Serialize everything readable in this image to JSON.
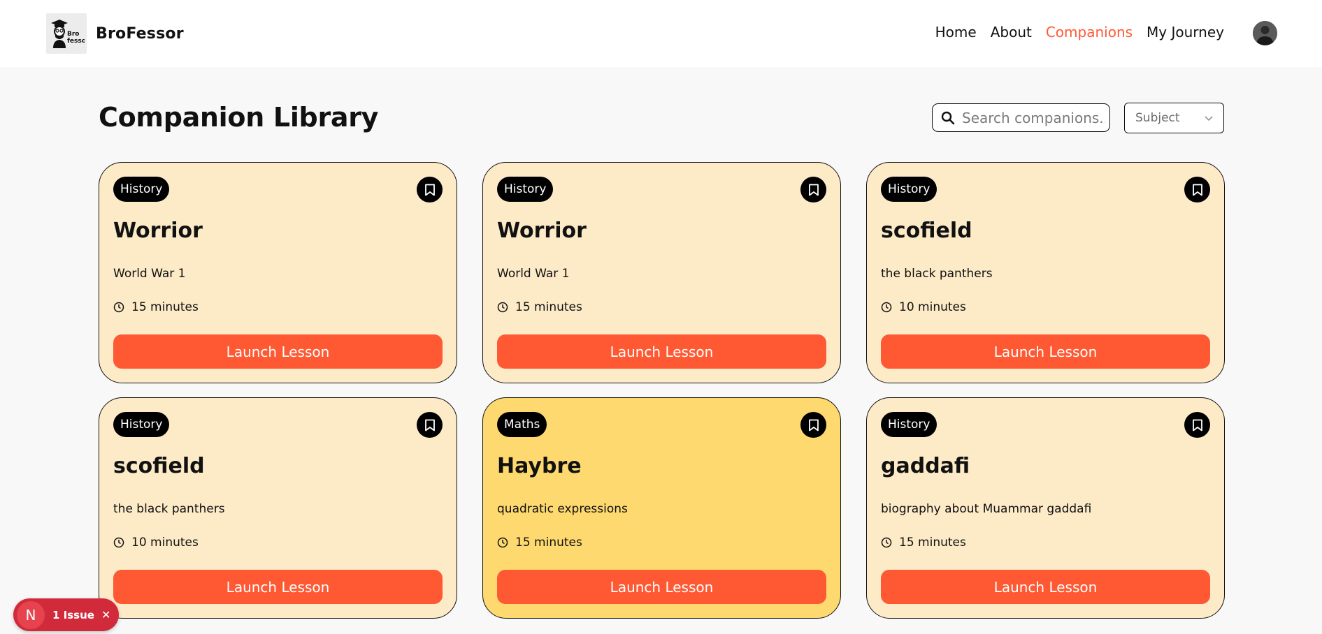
{
  "brand": {
    "name": "BroFessor",
    "logo_text_top": "Bro",
    "logo_text_bottom": "fessor"
  },
  "nav": {
    "links": [
      {
        "label": "Home",
        "active": false
      },
      {
        "label": "About",
        "active": false
      },
      {
        "label": "Companions",
        "active": true
      },
      {
        "label": "My Journey",
        "active": false
      }
    ]
  },
  "page": {
    "title": "Companion Library"
  },
  "search": {
    "placeholder": "Search companions...",
    "value": ""
  },
  "filter": {
    "subject_label": "Subject"
  },
  "cards": [
    {
      "subject": "History",
      "name": "Worrior",
      "topic": "World War 1",
      "duration": "15 minutes",
      "button": "Launch Lesson",
      "color": "#fdebc8"
    },
    {
      "subject": "History",
      "name": "Worrior",
      "topic": "World War 1",
      "duration": "15 minutes",
      "button": "Launch Lesson",
      "color": "#fdebc8"
    },
    {
      "subject": "History",
      "name": "scofield",
      "topic": "the black panthers",
      "duration": "10 minutes",
      "button": "Launch Lesson",
      "color": "#fdebc8"
    },
    {
      "subject": "History",
      "name": "scofield",
      "topic": "the black panthers",
      "duration": "10 minutes",
      "button": "Launch Lesson",
      "color": "#fdebc8"
    },
    {
      "subject": "Maths",
      "name": "Haybre",
      "topic": "quadratic expressions",
      "duration": "15 minutes",
      "button": "Launch Lesson",
      "color": "#fed96f"
    },
    {
      "subject": "History",
      "name": "gaddafi",
      "topic": "biography about Muammar gaddafi",
      "duration": "15 minutes",
      "button": "Launch Lesson",
      "color": "#fdebc8"
    }
  ],
  "issues": {
    "badge": "N",
    "label": "1 Issue"
  },
  "colors": {
    "accent": "#fe5933",
    "card_history": "#fdebc8",
    "card_maths": "#fed96f",
    "issue_red": "#d12b3b"
  },
  "icons": [
    "search-icon",
    "chevron-down-icon",
    "bookmark-icon",
    "clock-icon",
    "close-icon"
  ]
}
